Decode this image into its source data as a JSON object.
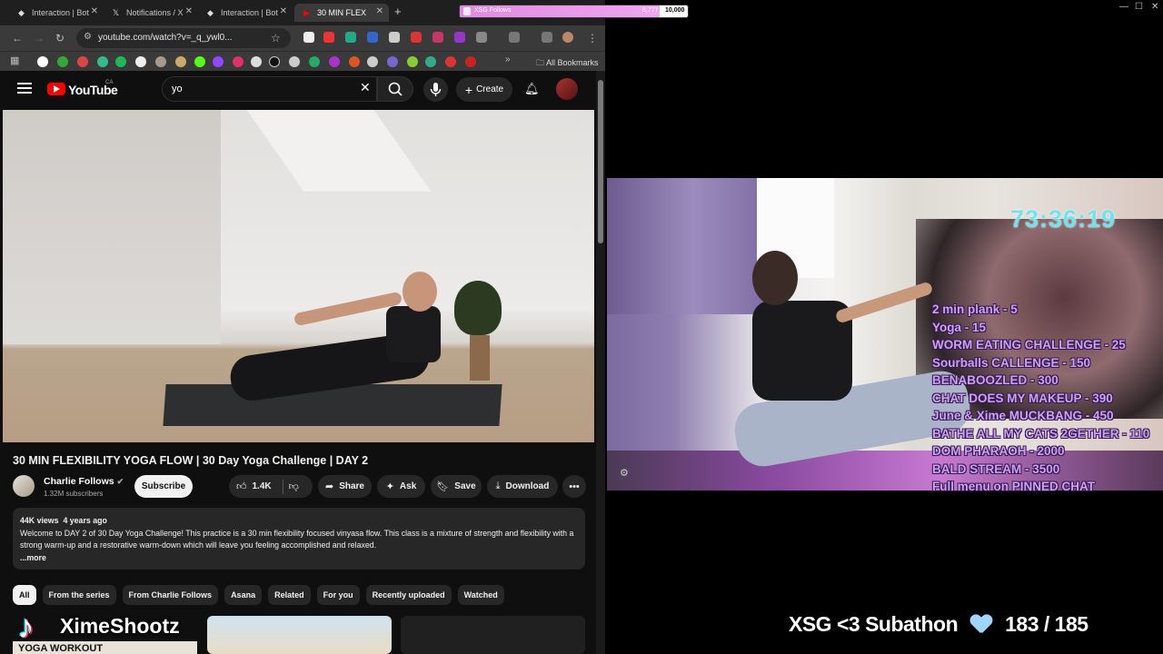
{
  "browser": {
    "tabs": [
      {
        "label": "Interaction | Bot",
        "icon": "bot-icon"
      },
      {
        "label": "Notifications / X",
        "icon": "x-icon"
      },
      {
        "label": "Interaction | Bot",
        "icon": "bot-icon"
      },
      {
        "label": "30 MIN FLEX",
        "icon": "youtube-icon"
      }
    ],
    "url": "youtube.com/watch?v=_q_ywl0...",
    "bookmarks_label": "All Bookmarks"
  },
  "youtube": {
    "logo_text": "YouTube",
    "region": "CA",
    "search_value": "yo",
    "create_label": "Create",
    "video_title": "30 MIN FLEXIBILITY YOGA FLOW | 30 Day Yoga Challenge | DAY 2",
    "channel": {
      "name": "Charlie Follows",
      "subscribers": "1.32M subscribers"
    },
    "subscribe_label": "Subscribe",
    "actions": {
      "likes": "1.4K",
      "share": "Share",
      "ask": "Ask",
      "save": "Save",
      "download": "Download"
    },
    "description": {
      "views": "44K views",
      "age": "4 years ago",
      "text": "Welcome to DAY 2 of 30 Day Yoga Challenge! This practice is a 30 min flexibility focused vinyasa flow. This class is a mixture of strength and flexibility with a strong warm-up and a restorative warm-down which will leave you feeling accomplished and relaxed.",
      "more": "...more"
    },
    "chips": [
      "All",
      "From the series",
      "From Charlie Follows",
      "Asana",
      "Related",
      "For you",
      "Recently uploaded",
      "Watched"
    ],
    "thumb_text": "YOGA WORKOUT"
  },
  "overlay": {
    "tiktok_name": "XimeShootz",
    "goal": {
      "label": "XSG Follows",
      "current": "8,777",
      "max": "10,000",
      "progress": 0.8777
    },
    "timer": "73:36:19",
    "menu": [
      "2 min plank - 5",
      "Yoga - 15",
      "WORM EATING CHALLENGE - 25",
      "Sourballs CALLENGE - 150",
      "BENABOOZLED - 300",
      "CHAT DOES MY MAKEUP - 390",
      "June & Xime MUCKBANG - 450",
      "BATHE ALL MY CATS 2GETHER - 110",
      "DOM PHARAOH - 2000",
      "BALD STREAM - 3500",
      "Full menu on PINNED CHAT"
    ],
    "subathon_label": "XSG <3 Subathon",
    "subathon_count": "183 / 185"
  }
}
